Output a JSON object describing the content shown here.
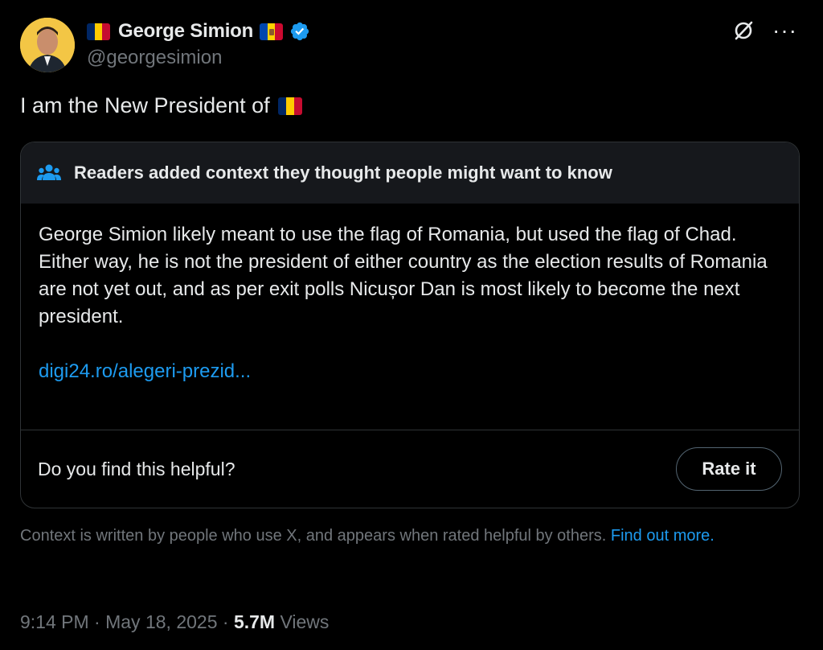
{
  "user": {
    "display_name": "George Simion",
    "handle": "@georgesimion",
    "verified_icon": "verified-badge-icon",
    "avatar_icon": "avatar-photo"
  },
  "tweet": {
    "text": "I am the New President of"
  },
  "note": {
    "header": "Readers added context they thought people might want to know",
    "body_1": "George Simion likely meant to use the flag of Romania, but used the flag of Chad.",
    "body_2": "Either way, he is not the president of either country as the election results of Romania are not yet out, and as per exit polls Nicușor Dan is most likely to become the next president.",
    "link": "digi24.ro/alegeri-prezid...",
    "question": "Do you find this helpful?",
    "rate_label": "Rate it"
  },
  "context_footer": {
    "text": "Context is written by people who use X, and appears when rated helpful by others.",
    "link": "Find out more."
  },
  "meta": {
    "time": "9:14 PM",
    "separator": "·",
    "date": "May 18, 2025",
    "views_count": "5.7M",
    "views_label": "Views"
  },
  "colors": {
    "background": "#000000",
    "accent": "#1d9bf0",
    "muted": "#71767b",
    "note_header_bg": "#16181c",
    "flag_blue": "#002b7f",
    "flag_yellow": "#fcd116",
    "flag_red": "#ce1126"
  }
}
